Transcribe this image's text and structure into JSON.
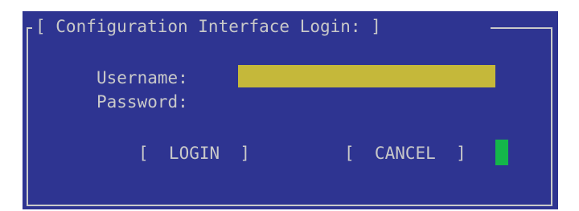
{
  "dialog": {
    "title": "[ Configuration Interface Login: ]"
  },
  "form": {
    "username_label": "Username:",
    "password_label": "Password:",
    "username_value": "",
    "password_value": ""
  },
  "buttons": {
    "login_label": "[  LOGIN  ]",
    "cancel_label": "[  CANCEL  ]"
  },
  "colors": {
    "panel_background": "#2e3491",
    "text": "#c9c9c9",
    "active_field": "#c5b83a",
    "cursor": "#14b64a"
  }
}
